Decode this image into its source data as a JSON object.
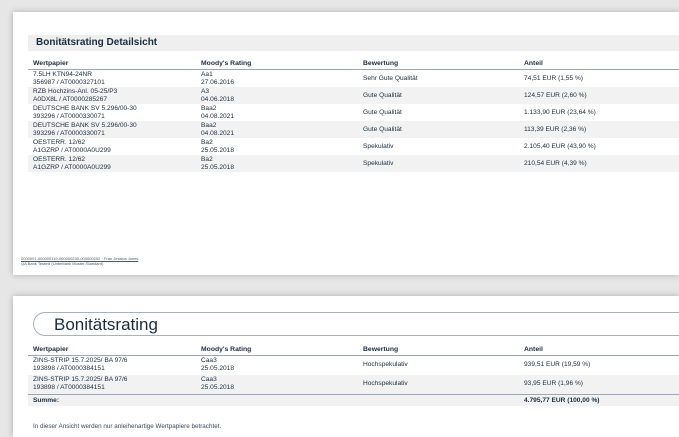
{
  "detail": {
    "title": "Bonitätsrating Detailsicht",
    "headers": {
      "wertpapier": "Wertpapier",
      "rating": "Moody's Rating",
      "bewertung": "Bewertung",
      "anteil": "Anteil"
    },
    "rows": [
      {
        "name": "7.5LH KTN94-24NR",
        "id": "356987 / AT0000327101",
        "rating": "Aa1",
        "date": "27.06.2016",
        "bewertung": "Sehr Gute Qualität",
        "anteil": "74,51 EUR (1,55 %)"
      },
      {
        "name": "RZB Hochzins-Anl. 05-25/P3",
        "id": "A0DX8L / AT0000285267",
        "rating": "A3",
        "date": "04.06.2018",
        "bewertung": "Gute Qualität",
        "anteil": "124,57 EUR (2,60 %)"
      },
      {
        "name": "DEUTSCHE BANK SV 5.296/00-30",
        "id": "393296 / AT0000330071",
        "rating": "Baa2",
        "date": "04.08.2021",
        "bewertung": "Gute Qualität",
        "anteil": "1.133,90 EUR (23,64 %)"
      },
      {
        "name": "DEUTSCHE BANK SV 5.296/00-30",
        "id": "393296 / AT0000330071",
        "rating": "Baa2",
        "date": "04.08.2021",
        "bewertung": "Gute Qualität",
        "anteil": "113,39 EUR (2,36 %)"
      },
      {
        "name": "OESTERR. 12/62",
        "id": "A1GZRP / AT0000A0U299",
        "rating": "Ba2",
        "date": "25.05.2018",
        "bewertung": "Spekulativ",
        "anteil": "2.105,40 EUR (43,90 %)"
      },
      {
        "name": "OESTERR. 12/62",
        "id": "A1GZRP / AT0000A0U299",
        "rating": "Ba2",
        "date": "25.05.2018",
        "bewertung": "Spekulativ",
        "anteil": "210,54 EUR (4,39 %)"
      }
    ],
    "footer_line1": "0000001-000000119-000000230-000000202 · Frau Jessica Jones",
    "footer_line2": "QA Bank Testmil (Unterbank Muster-Standard)"
  },
  "summary": {
    "title": "Bonitätsrating",
    "headers": {
      "wertpapier": "Wertpapier",
      "rating": "Moody's Rating",
      "bewertung": "Bewertung",
      "anteil": "Anteil"
    },
    "rows": [
      {
        "name": "ZINS-STRIP 15.7.2025/ BA 97/6",
        "id": "193898 / AT0000384151",
        "rating": "Caa3",
        "date": "25.05.2018",
        "bewertung": "Hochspekulativ",
        "anteil": "939,51 EUR (19,59 %)"
      },
      {
        "name": "ZINS-STRIP 15.7.2025/ BA 97/6",
        "id": "193898 / AT0000384151",
        "rating": "Caa3",
        "date": "25.05.2018",
        "bewertung": "Hochspekulativ",
        "anteil": "93,95 EUR (1,96 %)"
      }
    ],
    "sum_label": "Summe:",
    "sum_value": "4.795,77 EUR (100,00 %)",
    "note": "In dieser Ansicht werden nur anleihenartige Wertpapiere betrachtet."
  }
}
